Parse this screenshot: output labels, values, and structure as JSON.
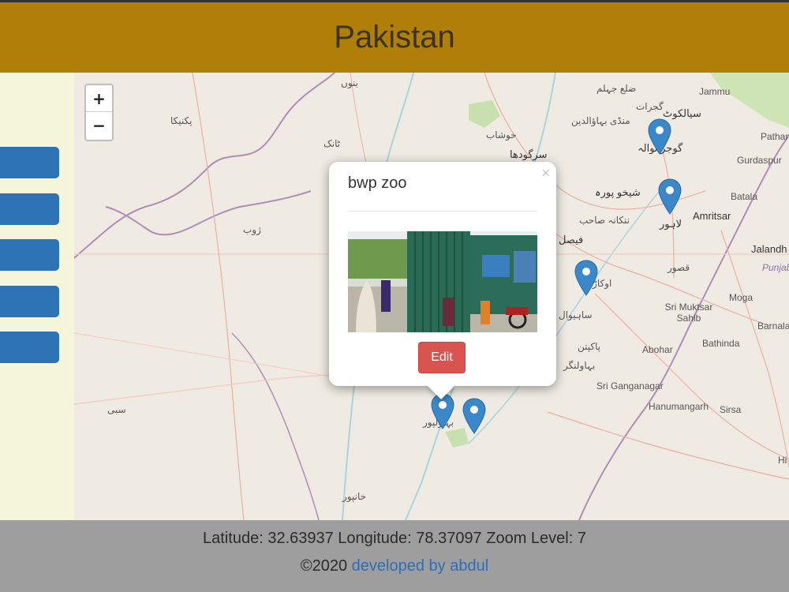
{
  "header": {
    "title": "Pakistan"
  },
  "map": {
    "zoom_in_label": "+",
    "zoom_out_label": "−",
    "place_labels": [
      "بنوں",
      "ضلع جہلم",
      "منڈی بہاؤالدین",
      "گجرات",
      "سیالکوٹ",
      "Jammu",
      "پکنیکا",
      "ٹانک",
      "خوشاب",
      "سرگودھا",
      "گوجرانوالہ",
      "Pathan",
      "Gurdaspur",
      "شیخو پورہ",
      "Batala",
      "ننکانہ صاحب",
      "Amritsar",
      "لاہور",
      "فیصل",
      "ژوب",
      "قصور",
      "Jalandh",
      "Punjab",
      "اوکاڑہ",
      "ساہیوال",
      "Moga",
      "Sri Muktsar Sahib",
      "Barnala",
      "پاکپتن",
      "Abohar",
      "Bathinda",
      "بہاولنگر",
      "Sri Ganganagar",
      "Hanumangarh",
      "Sirsa",
      "Hi",
      "سبی",
      "بہاولپور",
      "خانپور"
    ],
    "markers_color": "#3a87c9"
  },
  "popup": {
    "title": "bwp zoo",
    "close_label": "×",
    "edit_label": "Edit"
  },
  "footer": {
    "coords": "Latitude: 32.63937 Longitude: 78.37097 Zoom Level: 7",
    "copyright": "©2020 ",
    "link_text": "developed by abdul"
  },
  "colors": {
    "header_bg": "#b07f08",
    "sidebar_bg": "#f5f5dc",
    "sidebar_button": "#2f73b7",
    "edit_button": "#d9534f",
    "footer_bg": "#9e9e9e",
    "link": "#2f6db7"
  }
}
